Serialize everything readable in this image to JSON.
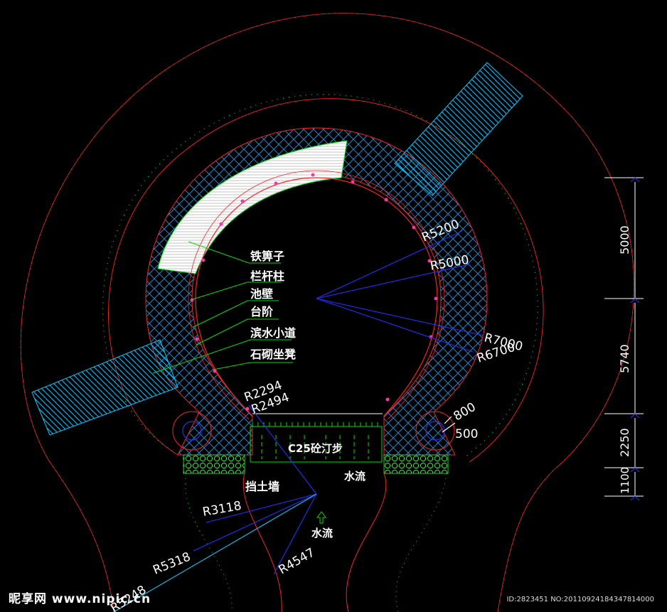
{
  "callouts": {
    "grate": "铁箅子",
    "railing_post": "栏杆柱",
    "pool_wall": "池壁",
    "step": "台阶",
    "waterfront_path": "滨水小道",
    "stone_seat": "石砌坐凳",
    "stepping_stones": "C25砼汀步",
    "retaining_wall": "挡土墙",
    "water_flow_right": "水流",
    "water_flow_center": "水流"
  },
  "radii": {
    "r5200": "R5200",
    "r5000": "R5000",
    "r7000": "R7000",
    "r6700": "R6700",
    "r2294": "R2294",
    "r2494": "R2494",
    "r3118": "R3118",
    "r5318": "R5318",
    "r4547": "R4547",
    "r_partial": "R5248"
  },
  "dimensions": {
    "d5000": "5000",
    "d5740": "5740",
    "d2250": "2250",
    "d1100": "1100",
    "d800": "800",
    "d500": "500"
  },
  "watermark": {
    "site": "昵享网 www.nipic.cn",
    "image_id": "ID:2823451 NO:20110924184347814000"
  },
  "colors": {
    "background": "#000000",
    "outer_boundary": "#00dd00",
    "red_outline": "#ff2020",
    "paving": "#1a8fd0",
    "grate_fill": "#ffffff",
    "stair": "#00c8ff",
    "radius_lines": "#2030ff",
    "dimension": "#ffffff",
    "planting": "#22ff22"
  }
}
